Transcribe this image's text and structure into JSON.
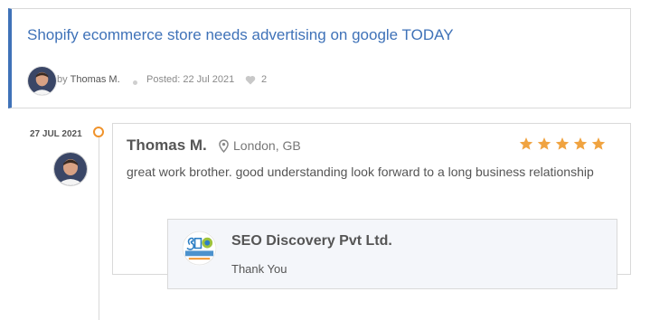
{
  "job": {
    "title": "Shopify ecommerce store needs advertising on google TODAY",
    "by_label": "by",
    "author": "Thomas M.",
    "posted": "Posted: 22 Jul 2021",
    "likes": "2"
  },
  "review": {
    "date": "27 JUL 2021",
    "reviewer": "Thomas M.",
    "location": "London, GB",
    "rating": 5,
    "text": "great work brother. good understanding look forward to a long business relationship"
  },
  "reply": {
    "company": "SEO Discovery Pvt Ltd.",
    "text": "Thank You"
  },
  "colors": {
    "accent": "#3f72b8",
    "star": "#f0a340",
    "timeline_dot": "#f0932b"
  },
  "icons": {
    "pin": "map-pin-icon",
    "heart": "heart-icon",
    "star": "star-icon"
  }
}
